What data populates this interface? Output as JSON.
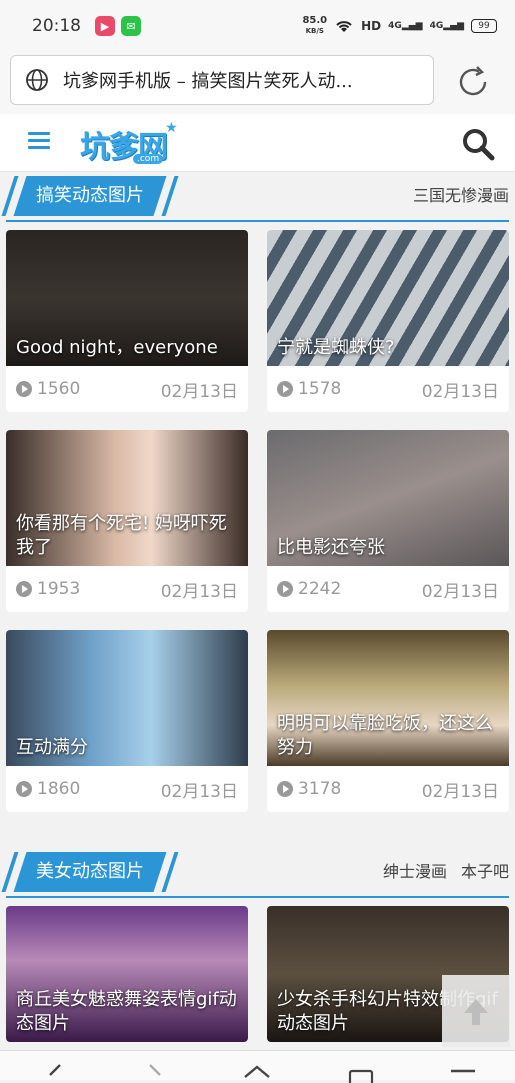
{
  "status_bar": {
    "time": "20:18",
    "netspeed_value": "85.0",
    "netspeed_unit": "KB/S",
    "hd": "HD",
    "signal1": "4G",
    "signal2": "4G",
    "battery": "99"
  },
  "browser": {
    "url_title": "坑爹网手机版 – 搞笑图片笑死人动..."
  },
  "site": {
    "logo": "坑爹网",
    "logo_sub": ".com"
  },
  "sections": [
    {
      "title": "搞笑动态图片",
      "links": [
        "三国无惨漫画"
      ],
      "cards": [
        {
          "caption": "Good night，everyone",
          "views": "1560",
          "date": "02月13日"
        },
        {
          "caption": "宁就是蜘蛛侠?",
          "views": "1578",
          "date": "02月13日"
        },
        {
          "caption": "你看那有个死宅! 妈呀吓死我了",
          "views": "1953",
          "date": "02月13日"
        },
        {
          "caption": "比电影还夸张",
          "views": "2242",
          "date": "02月13日"
        },
        {
          "caption": "互动满分",
          "views": "1860",
          "date": "02月13日"
        },
        {
          "caption": "明明可以靠脸吃饭，还这么努力",
          "views": "3178",
          "date": "02月13日"
        }
      ]
    },
    {
      "title": "美女动态图片",
      "links": [
        "绅士漫画",
        "本子吧"
      ],
      "cards": [
        {
          "caption": "商丘美女魅惑舞姿表情gif动态图片"
        },
        {
          "caption": "少女杀手科幻片特效制作gif动态图片"
        }
      ]
    }
  ]
}
